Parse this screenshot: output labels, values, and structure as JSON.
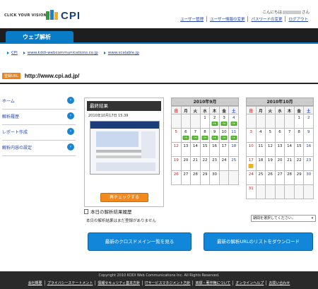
{
  "brand": {
    "tagline": "CLICK YOUR VISION",
    "logo": "CPI"
  },
  "header": {
    "greeting_prefix": "こんにちは",
    "greeting_suffix": "さん",
    "links": [
      "ユーザー管理",
      "ユーザー情報の変更",
      "パスワードの変更",
      "ログアウト"
    ]
  },
  "nav": {
    "active_tab": "ウェブ解析"
  },
  "sublinks": [
    "CPI",
    "www.kddi-webcommunications.co.jp",
    "www.scalable.jp"
  ],
  "url_row": {
    "badge": "登録URL",
    "url": "http://www.cpi.ad.jp/"
  },
  "sidebar": {
    "items": [
      {
        "label": "ホーム",
        "icon": "arrow-right-circle-icon"
      },
      {
        "label": "解析履歴",
        "icon": "arrow-right-circle-icon"
      },
      {
        "label": "レポート作成",
        "icon": "arrow-right-circle-icon"
      },
      {
        "label": "解析内容の設定",
        "icon": "arrow-right-circle-icon"
      }
    ]
  },
  "result_panel": {
    "title": "最終結果",
    "date": "2010年10月17日 15:39",
    "recheck_label": "再チェックする"
  },
  "history": {
    "title": "本日の解析結果履歴",
    "empty_text": "本日の解析結果はまだ登録がありません"
  },
  "calendars": [
    {
      "title": "2010年9月",
      "weekdays": [
        "日",
        "月",
        "火",
        "水",
        "木",
        "金",
        "土"
      ],
      "weeks": [
        [
          null,
          null,
          null,
          "1",
          "2",
          "3",
          "4"
        ],
        [
          "5",
          "6",
          "7",
          "8",
          "9",
          "10",
          "11"
        ],
        [
          "12",
          "13",
          "14",
          "15",
          "16",
          "17",
          "18"
        ],
        [
          "19",
          "20",
          "21",
          "22",
          "23",
          "24",
          "25"
        ],
        [
          "26",
          "27",
          "28",
          "29",
          "30",
          null,
          null
        ]
      ],
      "ok_days": [
        "2",
        "3",
        "4",
        "6",
        "7",
        "8",
        "9",
        "10",
        "11"
      ]
    },
    {
      "title": "2010年10月",
      "weekdays": [
        "日",
        "月",
        "火",
        "水",
        "木",
        "金",
        "土"
      ],
      "weeks": [
        [
          null,
          null,
          null,
          null,
          null,
          "1",
          "2"
        ],
        [
          "3",
          "4",
          "5",
          "6",
          "7",
          "8",
          "9"
        ],
        [
          "10",
          "11",
          "12",
          "13",
          "14",
          "15",
          "16"
        ],
        [
          "17",
          "18",
          "19",
          "20",
          "21",
          "22",
          "23"
        ],
        [
          "24",
          "25",
          "26",
          "27",
          "28",
          "29",
          "30"
        ],
        [
          "31",
          null,
          null,
          null,
          null,
          null,
          null
        ]
      ],
      "marked_days": [
        "17"
      ]
    }
  ],
  "ok_label": "OK",
  "period_select": {
    "value": "期間を選択してください。"
  },
  "buttons": {
    "cross_domain": "最新のクロスドメイン一覧を見る",
    "download": "最新の解析URLのリストをダウンロード"
  },
  "footer": {
    "copyright": "Copyright 2010 KDDI Web Communications Inc. All Rights Reserved.",
    "links": [
      "会社概要",
      "プライバシーステートメント",
      "情報セキュリティ基本方針",
      "ITサービスマネジメント方針",
      "商標・著作権について",
      "オンラインヘルプ",
      "お問い合わせ"
    ]
  },
  "colors": {
    "accent": "#0a7bc6",
    "orange": "#f08a1c",
    "ok_green": "#4fae2a",
    "nav_dark": "#1e1e1e"
  }
}
